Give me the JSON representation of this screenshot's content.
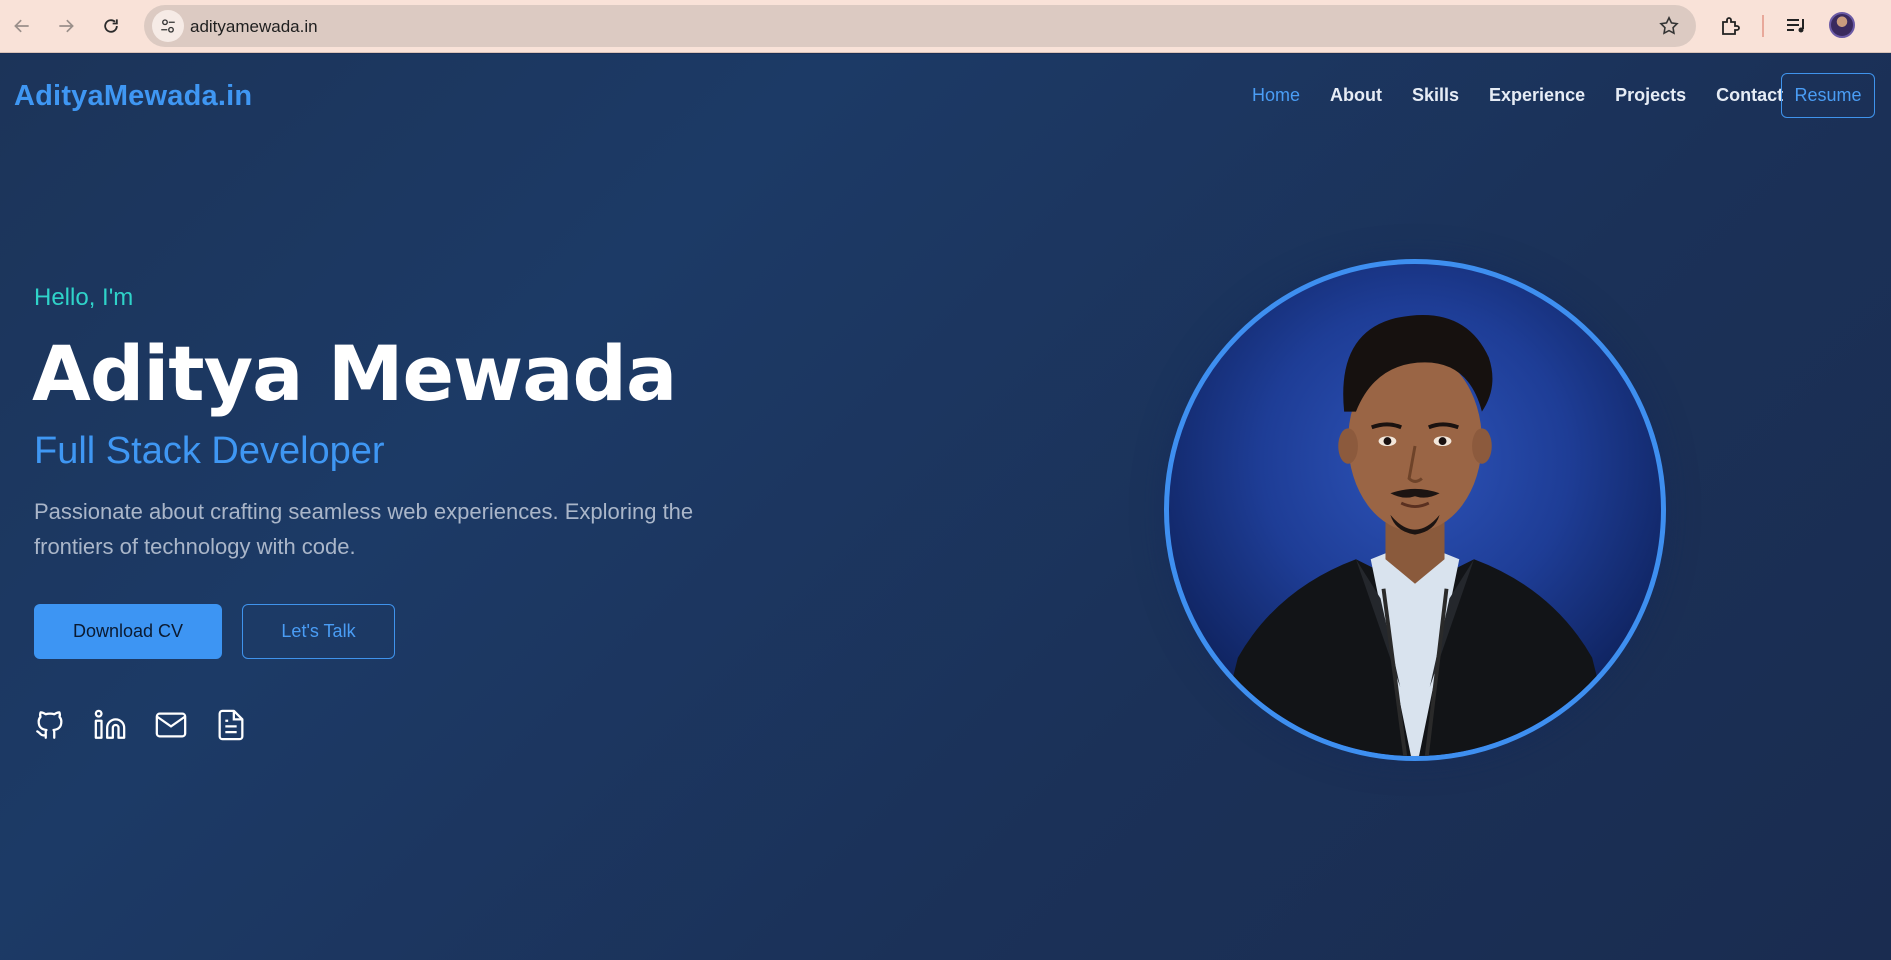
{
  "browser": {
    "url": "adityamewada.in"
  },
  "site": {
    "logo": "AdityaMewada.in",
    "nav": [
      "Home",
      "About",
      "Skills",
      "Experience",
      "Projects",
      "Contact"
    ],
    "nav_active": "Home",
    "resume_label": "Resume"
  },
  "hero": {
    "greeting": "Hello, I'm",
    "name": "Aditya Mewada",
    "role": "Full Stack Developer",
    "description": "Passionate about crafting seamless web experiences. Exploring the frontiers of technology with code.",
    "primary_button": "Download CV",
    "secondary_button": "Let's Talk",
    "social_icons": [
      "github-icon",
      "linkedin-icon",
      "mail-icon",
      "document-icon"
    ]
  },
  "colors": {
    "accent": "#3f97f3",
    "greeting": "#2fd3c9",
    "background": "#1c3459"
  }
}
